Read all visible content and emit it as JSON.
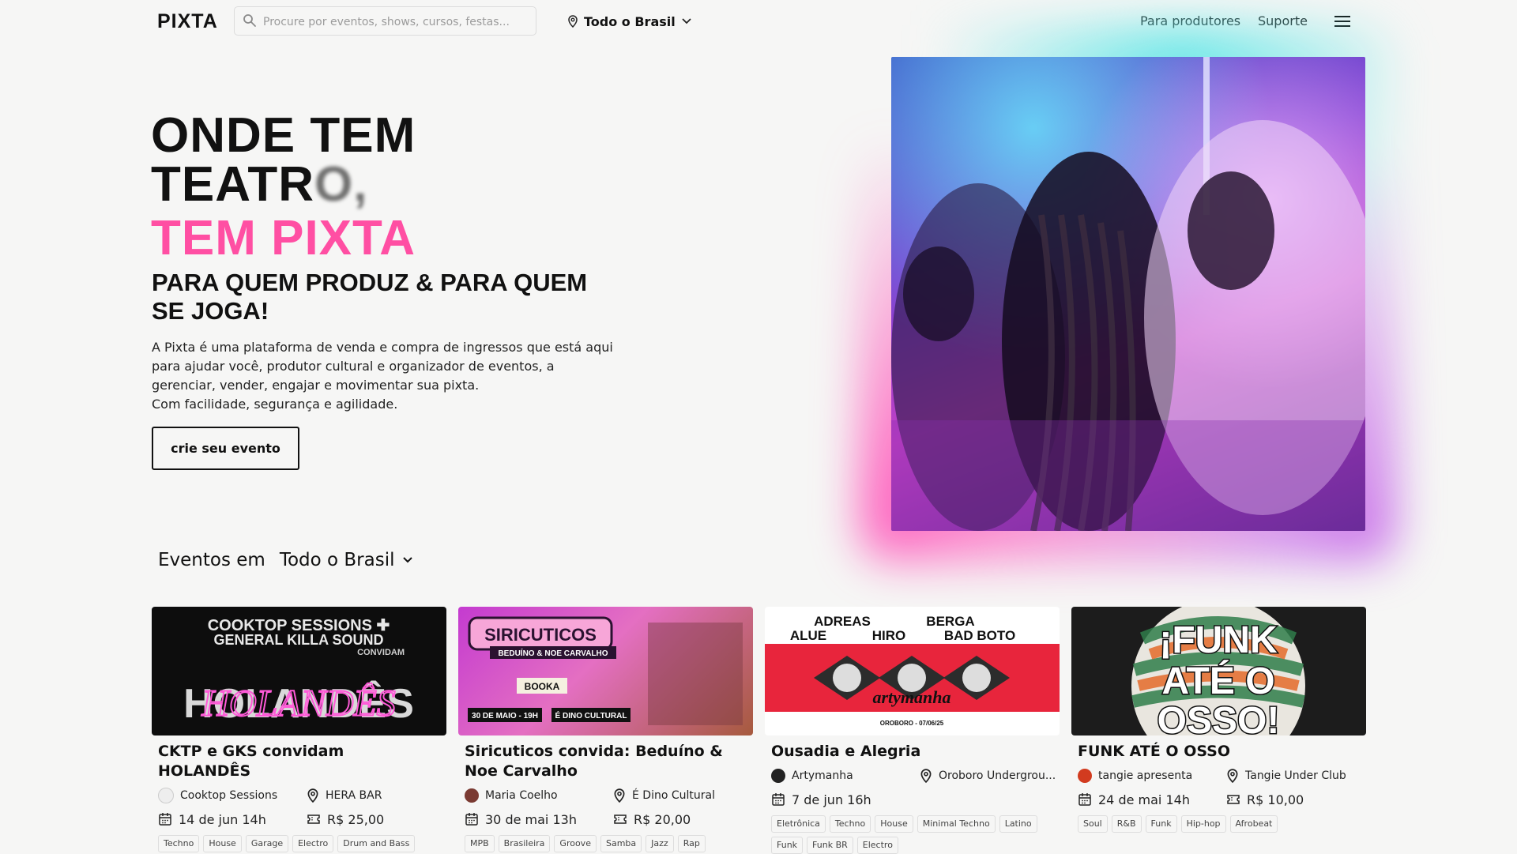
{
  "header": {
    "logo": "PIXTA",
    "search_placeholder": "Procure por eventos, shows, cursos, festas...",
    "location": "Todo o Brasil",
    "nav": [
      "Para produtores",
      "Suporte"
    ]
  },
  "hero": {
    "title_line1": "ONDE TEM",
    "title_line2_main": "TEATR",
    "title_line2_blur": "O,",
    "title_pink": "TEM PIXTA",
    "subtitle": "PARA QUEM PRODUZ & PARA QUEM SE JOGA!",
    "desc_line1": "A Pixta é uma plataforma de venda e compra de ingressos que está aqui para ajudar você, produtor cultural e organizador de eventos, a gerenciar, vender, engajar e movimentar sua pixta.",
    "desc_line2": "Com facilidade, segurança e agilidade.",
    "cta": "crie seu evento"
  },
  "events": {
    "heading": "Eventos em",
    "location": "Todo o Brasil",
    "cards": [
      {
        "title": "CKTP e GKS convidam HOLANDÊS",
        "producer": "Cooktop Sessions",
        "venue": "HERA BAR",
        "date": "14 de jun 14h",
        "price": "R$ 25,00",
        "tags": [
          "Techno",
          "House",
          "Garage",
          "Electro",
          "Drum and Bass"
        ],
        "poster": {
          "l1": "COOKTOP SESSIONS ✚",
          "l2": "GENERAL KILLA SOUND",
          "l3": "CONVIDAM",
          "l4": "HOLANDÊS"
        }
      },
      {
        "title": "Siricuticos convida: Beduíno & Noe Carvalho",
        "producer": "Maria Coelho",
        "venue": "É Dino Cultural",
        "date": "30 de mai 13h",
        "price": "R$ 20,00",
        "tags": [
          "MPB",
          "Brasileira",
          "Groove",
          "Samba",
          "Jazz",
          "Rap"
        ],
        "poster": {
          "l1": "SIRICUTICOS",
          "l2": "BEDUÍNO & NOE CARVALHO",
          "l3": "30 DE MAIO - 19H",
          "l4": "É DINO CULTURAL"
        }
      },
      {
        "title": "Ousadia e Alegria",
        "producer": "Artymanha",
        "venue": "Oroboro Undergrou...",
        "date": "7 de jun 16h",
        "price": "",
        "tags": [
          "Eletrônica",
          "Techno",
          "House",
          "Minimal Techno",
          "Latino",
          "Funk",
          "Funk BR",
          "Electro"
        ],
        "poster": {
          "l1": "ADREAS",
          "l2": "BERGA",
          "l3": "ALUE",
          "l4": "HIRO",
          "l5": "BAD BOTO",
          "l6": "artymanha",
          "l7": "OROBORO - 07/06/25"
        }
      },
      {
        "title": "FUNK ATÉ O OSSO",
        "producer": "tangie apresenta",
        "venue": "Tangie Under Club",
        "date": "24 de mai 14h",
        "price": "R$ 10,00",
        "tags": [
          "Soul",
          "R&B",
          "Funk",
          "Hip-hop",
          "Afrobeat"
        ],
        "poster": {
          "l1": "¡FUNK",
          "l2": "ATÉ O",
          "l3": "OSSO!"
        }
      }
    ]
  },
  "colors": {
    "accent_pink": "#ff4fa3",
    "background": "#f6f6f5",
    "text": "#111111"
  }
}
